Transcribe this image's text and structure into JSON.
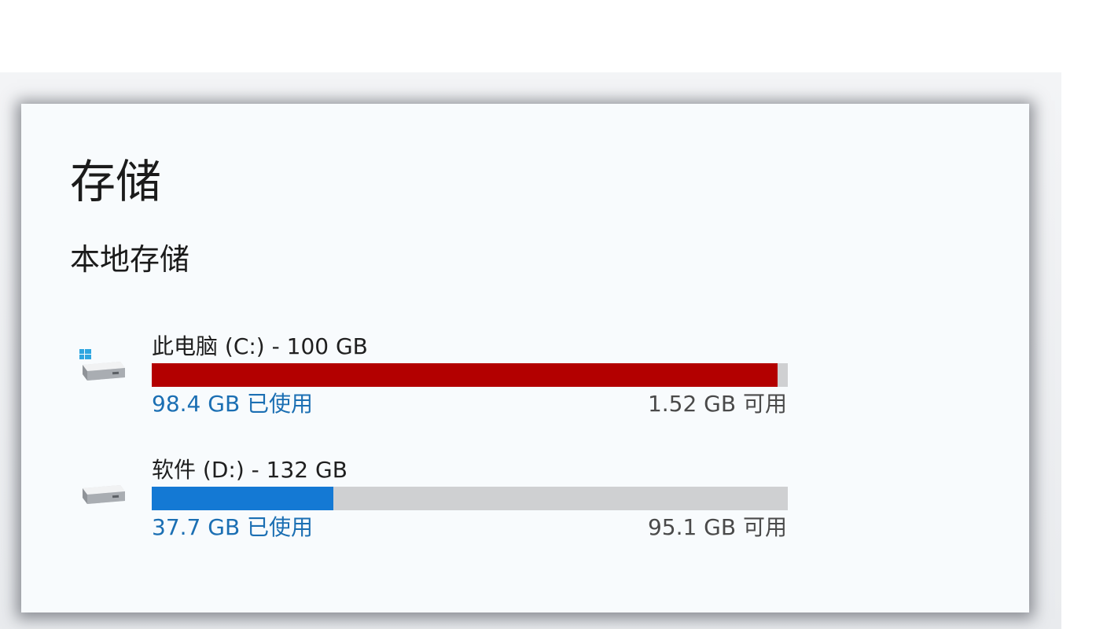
{
  "page": {
    "title": "存储",
    "section_title": "本地存储"
  },
  "drives": [
    {
      "name": "此电脑 (C:) - 100 GB",
      "used": "98.4 GB 已使用",
      "free": "1.52 GB 可用",
      "used_fraction": 0.984,
      "bar_color": "#b30000",
      "icon": "windows-drive-icon"
    },
    {
      "name": "软件 (D:) - 132 GB",
      "used": "37.7 GB 已使用",
      "free": "95.1 GB 可用",
      "used_fraction": 0.285,
      "bar_color": "#1479d4",
      "icon": "drive-icon"
    }
  ],
  "colors": {
    "used_text": "#1b6fb3",
    "bar_track": "#cfd0d2",
    "windows_logo": "#2fa6e0"
  }
}
